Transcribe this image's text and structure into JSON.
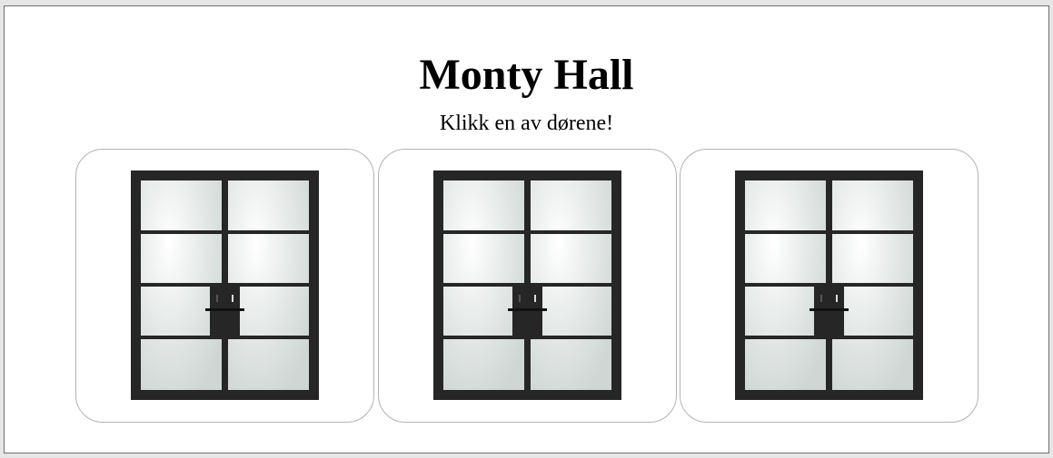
{
  "page": {
    "title": "Monty Hall",
    "instruction": "Klikk en av dørene!"
  },
  "doors": [
    {
      "icon": "double-glass-door-icon"
    },
    {
      "icon": "double-glass-door-icon"
    },
    {
      "icon": "double-glass-door-icon"
    }
  ],
  "colors": {
    "background": "#ffffff",
    "frame": "#262626",
    "glass": "#cfd6d3",
    "card_border": "#b3b3b3"
  }
}
